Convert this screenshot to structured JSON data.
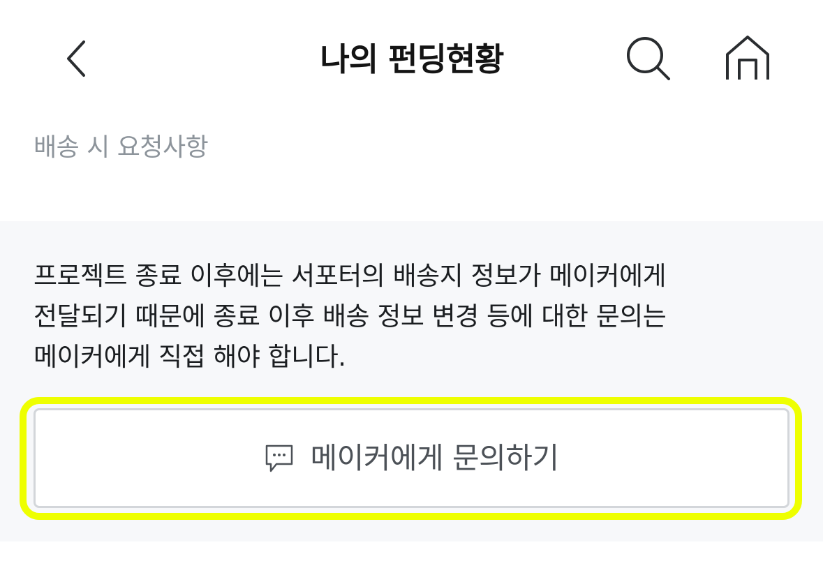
{
  "header": {
    "title": "나의 펀딩현황",
    "back_icon": "chevron-left-icon",
    "search_icon": "search-icon",
    "home_icon": "home-icon"
  },
  "section": {
    "label": "배송 시 요청사항"
  },
  "notice": {
    "lines": [
      "프로젝트 종료 이후에는 서포터의 배송지 정보가 메이커에게",
      "전달되기 때문에 종료 이후 배송 정보 변경 등에 대한 문의는",
      "메이커에게 직접 해야 합니다."
    ]
  },
  "inquiry_button": {
    "label": "메이커에게 문의하기",
    "icon": "chat-bubble-icon"
  },
  "colors": {
    "highlight": "#eeff00",
    "panel_background": "#f7f8fa",
    "muted_text": "#8d949b"
  }
}
